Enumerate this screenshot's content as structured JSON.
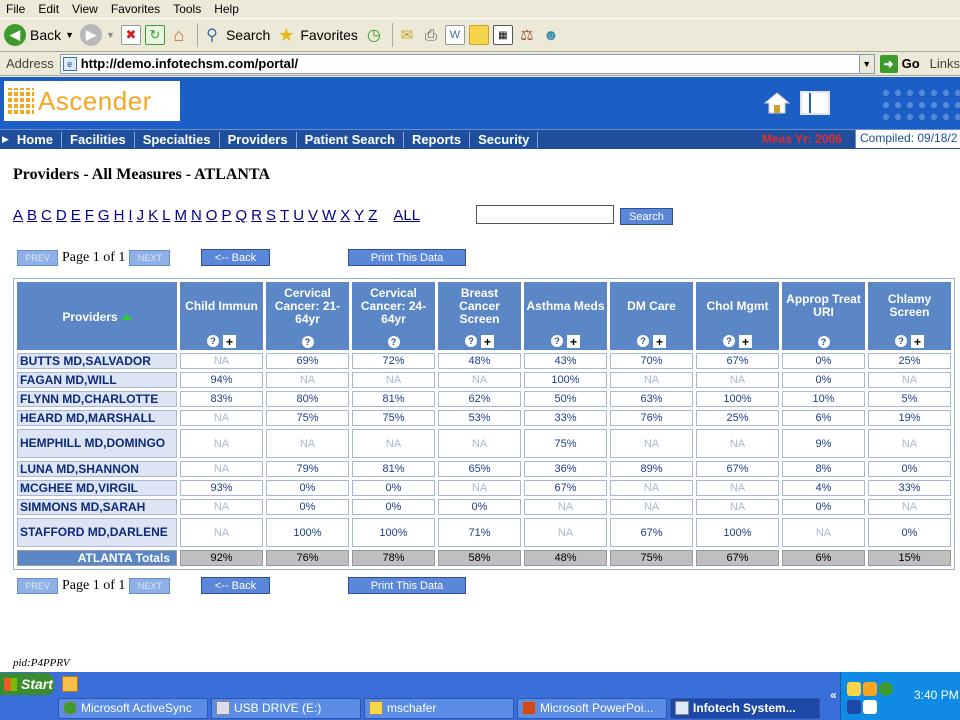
{
  "browser": {
    "menu": [
      "File",
      "Edit",
      "View",
      "Favorites",
      "Tools",
      "Help"
    ],
    "toolbar": {
      "back": "Back",
      "search": "Search",
      "favorites": "Favorites"
    },
    "address_label": "Address",
    "url": "http://demo.infotechsm.com/portal/",
    "go": "Go",
    "links": "Links"
  },
  "app": {
    "logo": "Ascender",
    "nav": [
      "Home",
      "Facilities",
      "Specialties",
      "Providers",
      "Patient Search",
      "Reports",
      "Security"
    ],
    "meas_yr": "Meas Yr: 2006",
    "compiled": "Compiled: 09/18/2"
  },
  "page": {
    "title": "Providers - All Measures - ATLANTA",
    "letters": [
      "A",
      "B",
      "C",
      "D",
      "E",
      "F",
      "G",
      "H",
      "I",
      "J",
      "K",
      "L",
      "M",
      "N",
      "O",
      "P",
      "Q",
      "R",
      "S",
      "T",
      "U",
      "V",
      "W",
      "X",
      "Y",
      "Z"
    ],
    "all": "ALL",
    "search_btn": "Search",
    "prev": "PREV",
    "next": "NEXT",
    "page_text": "Page 1 of 1",
    "back_btn": "<-- Back",
    "print_btn": "Print This Data",
    "pid": "pid:P4PPRV"
  },
  "table": {
    "provider_header": "Providers",
    "columns": [
      {
        "label": "Child Immun",
        "plus": true
      },
      {
        "label": "Cervical Cancer: 21-64yr",
        "plus": false
      },
      {
        "label": "Cervical Cancer: 24-64yr",
        "plus": false
      },
      {
        "label": "Breast Cancer Screen",
        "plus": true
      },
      {
        "label": "Asthma Meds",
        "plus": true
      },
      {
        "label": "DM Care",
        "plus": true
      },
      {
        "label": "Chol Mgmt",
        "plus": true
      },
      {
        "label": "Approp Treat URI",
        "plus": false
      },
      {
        "label": "Chlamy Screen",
        "plus": true
      }
    ],
    "rows": [
      {
        "name": "BUTTS MD,SALVADOR",
        "values": [
          "NA",
          "69%",
          "72%",
          "48%",
          "43%",
          "70%",
          "67%",
          "0%",
          "25%"
        ]
      },
      {
        "name": "FAGAN MD,WILL",
        "values": [
          "94%",
          "NA",
          "NA",
          "NA",
          "100%",
          "NA",
          "NA",
          "0%",
          "NA"
        ]
      },
      {
        "name": "FLYNN MD,CHARLOTTE",
        "values": [
          "83%",
          "80%",
          "81%",
          "62%",
          "50%",
          "63%",
          "100%",
          "10%",
          "5%"
        ]
      },
      {
        "name": "HEARD MD,MARSHALL",
        "values": [
          "NA",
          "75%",
          "75%",
          "53%",
          "33%",
          "76%",
          "25%",
          "6%",
          "19%"
        ]
      },
      {
        "name": "HEMPHILL MD,DOMINGO",
        "values": [
          "NA",
          "NA",
          "NA",
          "NA",
          "75%",
          "NA",
          "NA",
          "9%",
          "NA"
        ]
      },
      {
        "name": "LUNA MD,SHANNON",
        "values": [
          "NA",
          "79%",
          "81%",
          "65%",
          "36%",
          "89%",
          "67%",
          "8%",
          "0%"
        ]
      },
      {
        "name": "MCGHEE MD,VIRGIL",
        "values": [
          "93%",
          "0%",
          "0%",
          "NA",
          "67%",
          "NA",
          "NA",
          "4%",
          "33%"
        ]
      },
      {
        "name": "SIMMONS MD,SARAH",
        "values": [
          "NA",
          "0%",
          "0%",
          "0%",
          "NA",
          "NA",
          "NA",
          "0%",
          "NA"
        ]
      },
      {
        "name": "STAFFORD MD,DARLENE",
        "values": [
          "NA",
          "100%",
          "100%",
          "71%",
          "NA",
          "67%",
          "100%",
          "NA",
          "0%"
        ]
      }
    ],
    "totals_label": "ATLANTA Totals",
    "totals": [
      "92%",
      "76%",
      "78%",
      "58%",
      "48%",
      "75%",
      "67%",
      "6%",
      "15%"
    ]
  },
  "taskbar": {
    "start": "Start",
    "tasks": [
      "Microsoft ActiveSync",
      "USB DRIVE (E:)",
      "mschafer",
      "Microsoft PowerPoi...",
      "Infotech System..."
    ],
    "tray_arrow": "«",
    "clock": "3:40 PM"
  }
}
